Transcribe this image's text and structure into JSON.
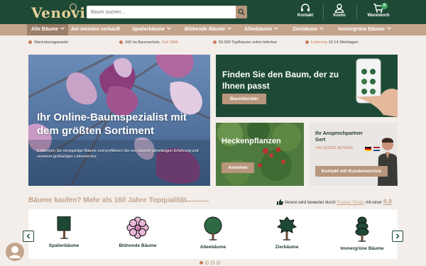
{
  "header": {
    "logo": "Venovi",
    "search_placeholder": "Baum suchen...",
    "contact_label": "Kontakt",
    "account_label": "Konto",
    "cart_label": "Warenkorb",
    "cart_count": "0"
  },
  "nav": {
    "items": [
      {
        "label": "Alle Bäume"
      },
      {
        "label": "Am meisten verkauft"
      },
      {
        "label": "Spalierbäume"
      },
      {
        "label": "Blühende Bäume"
      },
      {
        "label": "Alleebäume"
      },
      {
        "label": "Zierbäume"
      },
      {
        "label": "Immergrüne Bäume"
      }
    ]
  },
  "usp": {
    "item1": "Wachstumsgarantie",
    "item2_text": "160 ha Baumschule,",
    "item2_highlight": "Seit 1865",
    "item3": "50.000 Topfbäume sofort lieferbar",
    "item4_highlight": "Lieferung",
    "item4_text": "10-14 Werktagen"
  },
  "hero": {
    "title": "Ihr Online-Baumspezialist mit dem größten Sortiment",
    "subtitle": "Entdecken Sie einzigartige Bäume und profitieren Sie von unserer jahrelangen Erfahrung und unserem großartigen Lieferservice"
  },
  "finder": {
    "title": "Finden Sie den Baum, der zu Ihnen passt",
    "button": "Baumberater"
  },
  "hedge": {
    "title": "Heckenpflanzen",
    "button": "Ansehen"
  },
  "contact": {
    "title_line1": "Ihr Ansprechpartner",
    "title_line2": "Gert",
    "phone": "+49 (0)2561 8679900",
    "button": "Kontakt mit Kundenservice"
  },
  "section": {
    "title": "Bäume kaufen? Mehr als 160 Jahre Topqualität",
    "rating_text": "Venovi wird bewertet durch",
    "rating_link": "Trusted Shops",
    "rating_mid": "mit einer",
    "rating_score": "4,9"
  },
  "categories": [
    {
      "label": "Spalierbäume",
      "icon": "espalier-tree-icon"
    },
    {
      "label": "Blühende Bäume",
      "icon": "flower-icon"
    },
    {
      "label": "Alleebäume",
      "icon": "round-tree-icon"
    },
    {
      "label": "Zierbäume",
      "icon": "ornamental-tree-icon"
    },
    {
      "label": "Immergrüne Bäume",
      "icon": "evergreen-tree-icon"
    }
  ],
  "colors": {
    "primary_green": "#1e4a35",
    "tan": "#c4a48c",
    "accent": "#c97b5a"
  }
}
